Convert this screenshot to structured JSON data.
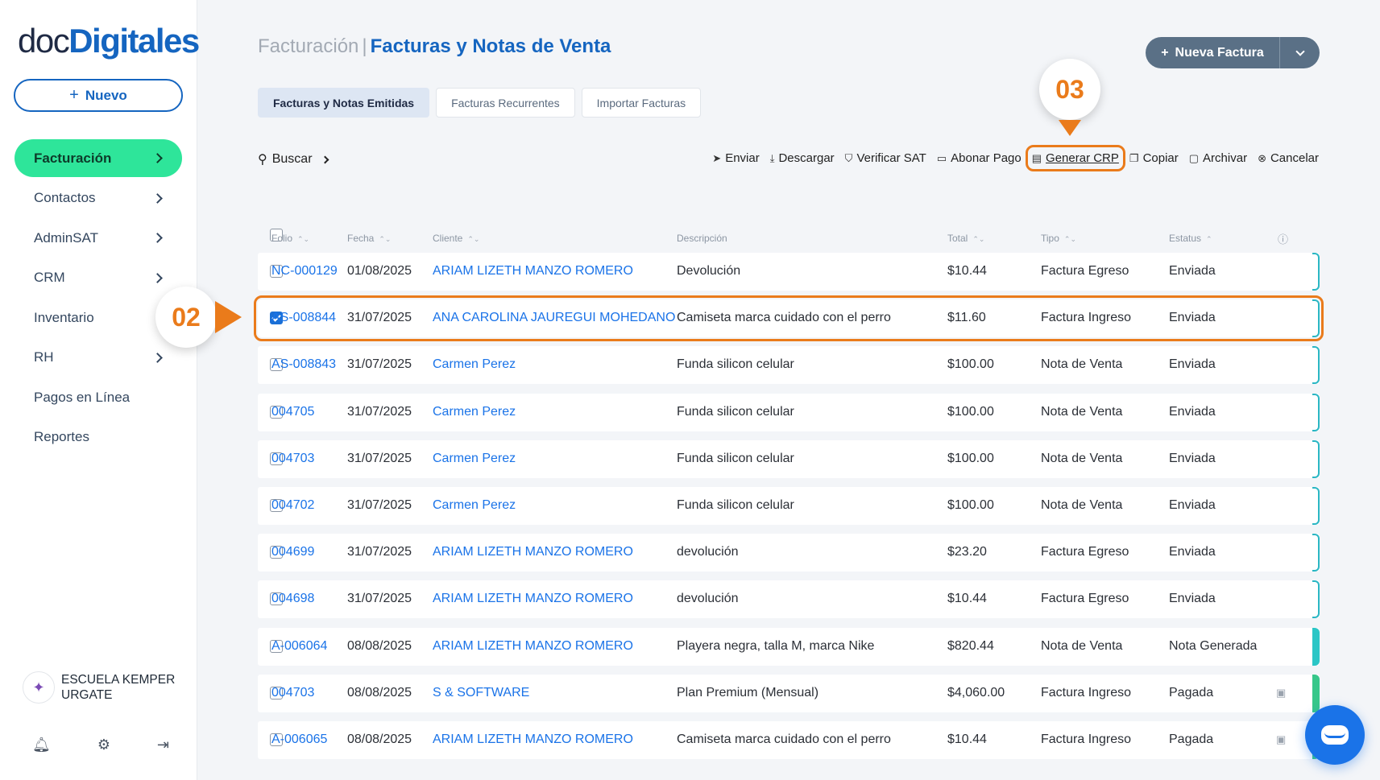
{
  "brand": {
    "logo_part1": "doc",
    "logo_part2": "Digitales"
  },
  "sidebar": {
    "new_button": "Nuevo",
    "items": [
      {
        "label": "Facturación",
        "active": true,
        "has_chevron": true
      },
      {
        "label": "Contactos",
        "has_chevron": true
      },
      {
        "label": "AdminSAT",
        "has_chevron": true
      },
      {
        "label": "CRM",
        "has_chevron": true
      },
      {
        "label": "Inventario",
        "has_chevron": false
      },
      {
        "label": "RH",
        "has_chevron": true
      },
      {
        "label": "Pagos en Línea",
        "has_chevron": false
      },
      {
        "label": "Reportes",
        "has_chevron": false
      }
    ],
    "user_name": "ESCUELA KEMPER URGATE",
    "footer_icons": [
      "bell-icon",
      "gear-icon",
      "logout-icon"
    ]
  },
  "header": {
    "crumb": "Facturación",
    "separator": "|",
    "current": "Facturas y Notas de Venta",
    "primary_button": "Nueva Factura"
  },
  "tabs": [
    "Facturas y Notas Emitidas",
    "Facturas Recurrentes",
    "Importar Facturas"
  ],
  "toolbar": {
    "search_label": "Buscar",
    "actions": [
      {
        "label": "Enviar",
        "icon": "send-icon"
      },
      {
        "label": "Descargar",
        "icon": "download-icon"
      },
      {
        "label": "Verificar SAT",
        "icon": "shield-check-icon"
      },
      {
        "label": "Abonar Pago",
        "icon": "cash-icon"
      },
      {
        "label": "Generar CRP",
        "icon": "document-icon",
        "highlighted": true
      },
      {
        "label": "Copiar",
        "icon": "copy-icon"
      },
      {
        "label": "Archivar",
        "icon": "folder-icon"
      },
      {
        "label": "Cancelar",
        "icon": "cancel-circle-icon"
      }
    ]
  },
  "table": {
    "columns": [
      "Folio",
      "Fecha",
      "Cliente",
      "Descripción",
      "Total",
      "Tipo",
      "Estatus"
    ],
    "rows": [
      {
        "folio": "NC-000129",
        "fecha": "01/08/2025",
        "cliente": "ARIAM LIZETH MANZO ROMERO",
        "descripcion": "Devolución",
        "total": "$10.44",
        "tipo": "Factura Egreso",
        "estatus": "Enviada",
        "checked": false,
        "bar": "outline"
      },
      {
        "folio": "AS-008844",
        "fecha": "31/07/2025",
        "cliente": "ANA CAROLINA JAUREGUI MOHEDANO",
        "descripcion": "Camiseta marca cuidado con el perro",
        "total": "$11.60",
        "tipo": "Factura Ingreso",
        "estatus": "Enviada",
        "checked": true,
        "bar": "outline"
      },
      {
        "folio": "AS-008843",
        "fecha": "31/07/2025",
        "cliente": "Carmen Perez",
        "descripcion": "Funda silicon celular",
        "total": "$100.00",
        "tipo": "Nota de Venta",
        "estatus": "Enviada",
        "checked": false,
        "bar": "outline"
      },
      {
        "folio": "004705",
        "fecha": "31/07/2025",
        "cliente": "Carmen Perez",
        "descripcion": "Funda silicon celular",
        "total": "$100.00",
        "tipo": "Nota de Venta",
        "estatus": "Enviada",
        "checked": false,
        "bar": "outline"
      },
      {
        "folio": "004703",
        "fecha": "31/07/2025",
        "cliente": "Carmen Perez",
        "descripcion": "Funda silicon celular",
        "total": "$100.00",
        "tipo": "Nota de Venta",
        "estatus": "Enviada",
        "checked": false,
        "bar": "outline"
      },
      {
        "folio": "004702",
        "fecha": "31/07/2025",
        "cliente": "Carmen Perez",
        "descripcion": "Funda silicon celular",
        "total": "$100.00",
        "tipo": "Nota de Venta",
        "estatus": "Enviada",
        "checked": false,
        "bar": "outline"
      },
      {
        "folio": "004699",
        "fecha": "31/07/2025",
        "cliente": "ARIAM LIZETH MANZO ROMERO",
        "descripcion": "devolución",
        "total": "$23.20",
        "tipo": "Factura Egreso",
        "estatus": "Enviada",
        "checked": false,
        "bar": "outline"
      },
      {
        "folio": "004698",
        "fecha": "31/07/2025",
        "cliente": "ARIAM LIZETH MANZO ROMERO",
        "descripcion": "devolución",
        "total": "$10.44",
        "tipo": "Factura Egreso",
        "estatus": "Enviada",
        "checked": false,
        "bar": "outline"
      },
      {
        "folio": "A-006064",
        "fecha": "08/08/2025",
        "cliente": "ARIAM LIZETH MANZO ROMERO",
        "descripcion": "Playera negra, talla M, marca Nike",
        "total": "$820.44",
        "tipo": "Nota de Venta",
        "estatus": "Nota Generada",
        "checked": false,
        "bar": "solid"
      },
      {
        "folio": "004703",
        "fecha": "08/08/2025",
        "cliente": "S & SOFTWARE",
        "descripcion": "Plan Premium (Mensual)",
        "total": "$4,060.00",
        "tipo": "Factura Ingreso",
        "estatus": "Pagada",
        "checked": false,
        "bar": "green",
        "receipt_icon": true
      },
      {
        "folio": "A-006065",
        "fecha": "08/08/2025",
        "cliente": "ARIAM LIZETH MANZO ROMERO",
        "descripcion": "Camiseta marca cuidado con el perro",
        "total": "$10.44",
        "tipo": "Factura Ingreso",
        "estatus": "Pagada",
        "checked": false,
        "bar": "green",
        "receipt_icon": true
      }
    ]
  },
  "callouts": {
    "step_a": "02",
    "step_b": "03"
  },
  "colors": {
    "brand_blue": "#1565c0",
    "active_green": "#2ee59a",
    "highlight_orange": "#ea7b1b",
    "link_blue": "#1a73e8"
  }
}
